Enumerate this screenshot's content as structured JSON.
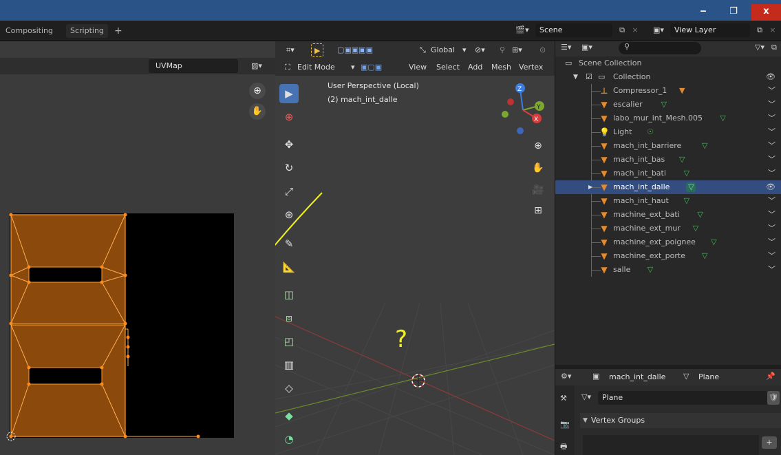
{
  "window": {
    "minimize": "‒",
    "maximize": "❐",
    "close": "x"
  },
  "workspaces": [
    {
      "label": "Compositing"
    },
    {
      "label": "Scripting"
    }
  ],
  "add_workspace": "+",
  "scene": {
    "value": "Scene"
  },
  "view_layer": {
    "value": "View Layer"
  },
  "uv_editor": {
    "uv_map": "UVMap",
    "zoom_icon": "⊕",
    "pan_icon": "✋"
  },
  "viewport": {
    "transform_orientation": "Global",
    "mode": "Edit Mode",
    "menus": [
      "View",
      "Select",
      "Add",
      "Mesh",
      "Vertex"
    ],
    "overlay_title": "User Perspective (Local)",
    "overlay_object": "(2) mach_int_dalle",
    "annotation_text": "?",
    "gizmo": {
      "z": "Z",
      "y": "Y",
      "x": "X"
    }
  },
  "outliner": {
    "search_placeholder": "",
    "scene_collection": "Scene Collection",
    "collection": "Collection",
    "items": [
      {
        "name": "Compressor_1",
        "selected": false,
        "kind": "mesh-mod"
      },
      {
        "name": "escalier",
        "selected": false,
        "kind": "mesh"
      },
      {
        "name": "labo_mur_int_Mesh.005",
        "selected": false,
        "kind": "mesh"
      },
      {
        "name": "Light",
        "selected": false,
        "kind": "light"
      },
      {
        "name": "mach_int_barriere",
        "selected": false,
        "kind": "mesh"
      },
      {
        "name": "mach_int_bas",
        "selected": false,
        "kind": "mesh"
      },
      {
        "name": "mach_int_bati",
        "selected": false,
        "kind": "mesh"
      },
      {
        "name": "mach_int_dalle",
        "selected": true,
        "kind": "mesh"
      },
      {
        "name": "mach_int_haut",
        "selected": false,
        "kind": "mesh"
      },
      {
        "name": "machine_ext_bati",
        "selected": false,
        "kind": "mesh"
      },
      {
        "name": "machine_ext_mur",
        "selected": false,
        "kind": "mesh"
      },
      {
        "name": "machine_ext_poignee",
        "selected": false,
        "kind": "mesh"
      },
      {
        "name": "machine_ext_porte",
        "selected": false,
        "kind": "mesh"
      },
      {
        "name": "salle",
        "selected": false,
        "kind": "mesh"
      }
    ]
  },
  "properties": {
    "object_name": "mach_int_dalle",
    "data_name": "Plane",
    "mesh_field": "Plane",
    "panel_vertex_groups": "Vertex Groups",
    "add": "+"
  },
  "colors": {
    "accent": "#4772b3",
    "orange": "#e58a2e",
    "uv_face": "#8b4a0c",
    "annotation": "#f0f020"
  }
}
